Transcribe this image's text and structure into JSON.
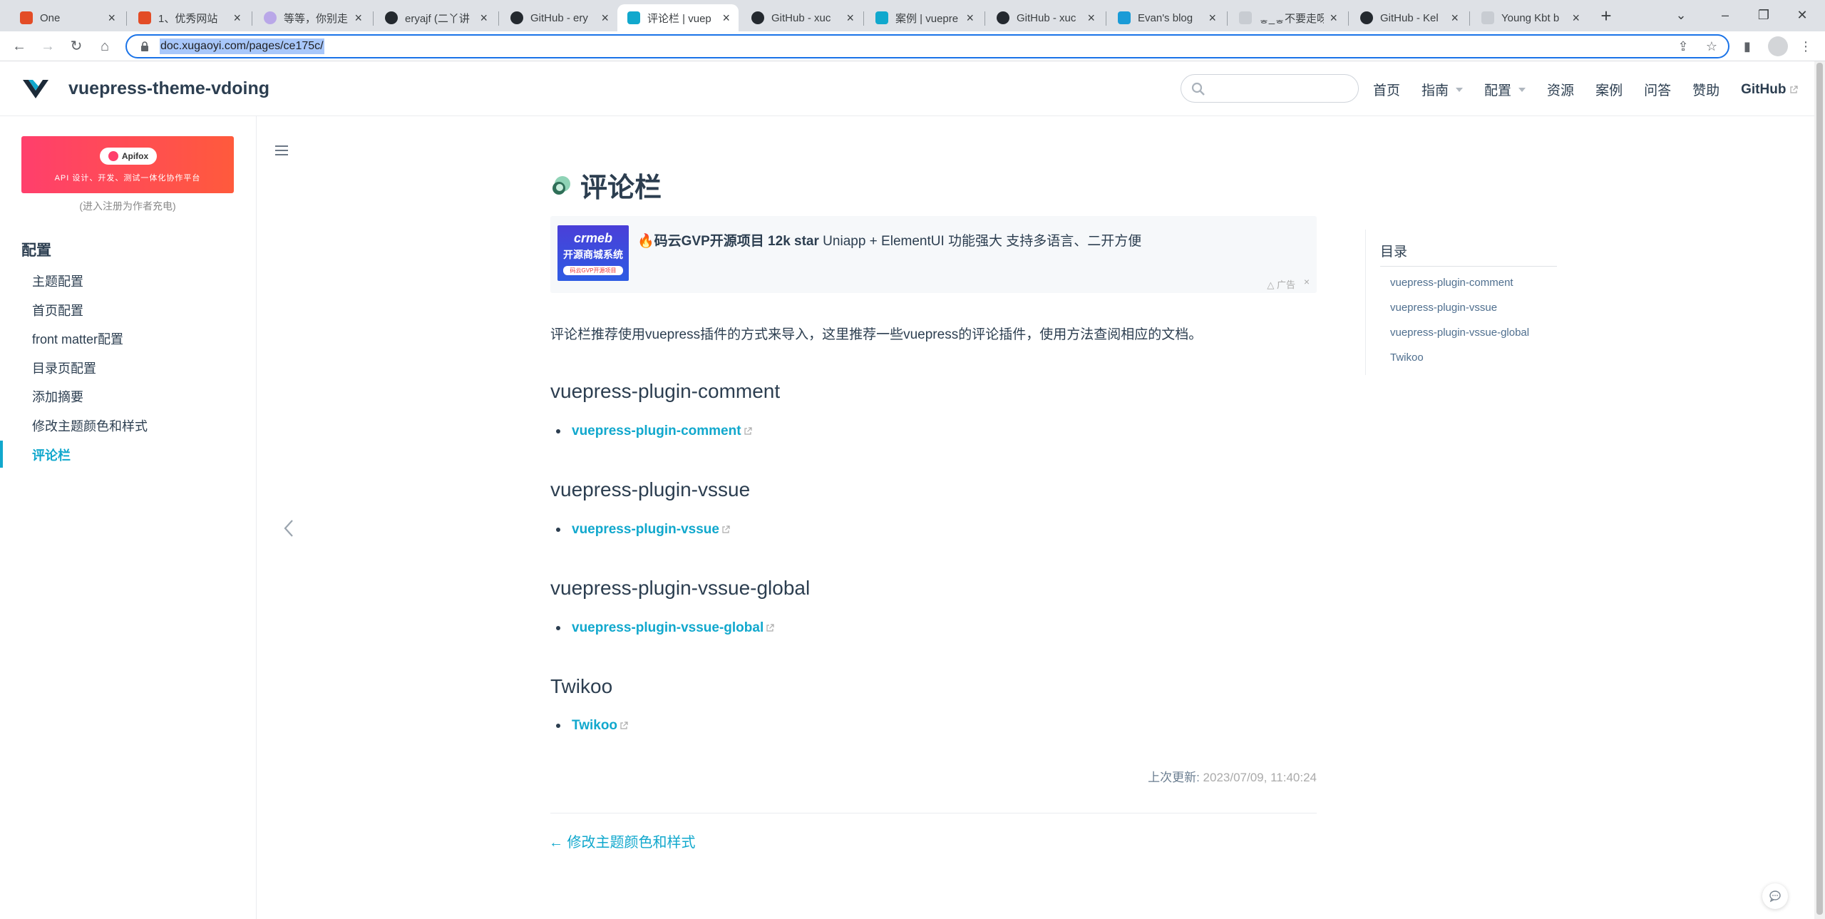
{
  "browser": {
    "tabs": [
      {
        "title": "One",
        "favicon_color": "#e34c26"
      },
      {
        "title": "1、优秀网站",
        "favicon_color": "#e34c26"
      },
      {
        "title": "等等，你别走",
        "favicon_color": "#b9a7e8"
      },
      {
        "title": "eryajf (二丫讲",
        "favicon_color": "#24292f"
      },
      {
        "title": "GitHub - ery",
        "favicon_color": "#24292f"
      },
      {
        "title": "评论栏 | vuep",
        "favicon_color": "#11a8cd"
      },
      {
        "title": "GitHub - xuc",
        "favicon_color": "#24292f"
      },
      {
        "title": "案例 | vuepre",
        "favicon_color": "#11a8cd"
      },
      {
        "title": "GitHub - xuc",
        "favicon_color": "#24292f"
      },
      {
        "title": "Evan's blog",
        "favicon_color": "#1a9bd7"
      },
      {
        "title": "ᇂ_ᇂ不要走呀",
        "favicon_color": "#9aa0a6"
      },
      {
        "title": "GitHub - Kel",
        "favicon_color": "#24292f"
      },
      {
        "title": "Young Kbt b",
        "favicon_color": "#9aa0a6"
      }
    ],
    "active_tab_index": 5,
    "url": "doc.xugaoyi.com/pages/ce175c/"
  },
  "navbar": {
    "site_name": "vuepress-theme-vdoing",
    "search_placeholder": "",
    "links": [
      {
        "label": "首页",
        "dropdown": false
      },
      {
        "label": "指南",
        "dropdown": true
      },
      {
        "label": "配置",
        "dropdown": true
      },
      {
        "label": "资源",
        "dropdown": false
      },
      {
        "label": "案例",
        "dropdown": false
      },
      {
        "label": "问答",
        "dropdown": false
      },
      {
        "label": "赞助",
        "dropdown": false
      }
    ],
    "github_label": "GitHub"
  },
  "sidebar": {
    "ad_brand": "Apifox",
    "ad_text": "API 设计、开发、测试一体化协作平台",
    "ad_note": "(进入注册为作者充电)",
    "group_title": "配置",
    "items": [
      "主题配置",
      "首页配置",
      "front matter配置",
      "目录页配置",
      "添加摘要",
      "修改主题颜色和样式",
      "评论栏"
    ],
    "active_index": 6
  },
  "main": {
    "title": "评论栏",
    "ad": {
      "img_line1": "crmeb",
      "img_line2": "开源商城系统",
      "img_line3": "码云GVP开源项目",
      "bold": "🔥码云GVP开源项目 12k star",
      "text": " Uniapp + ElementUI 功能强大 支持多语言、二开方便",
      "label": "广告",
      "close": "×"
    },
    "intro": "评论栏推荐使用vuepress插件的方式来导入，这里推荐一些vuepress的评论插件，使用方法查阅相应的文档。",
    "sections": [
      {
        "heading": "vuepress-plugin-comment",
        "link": "vuepress-plugin-comment"
      },
      {
        "heading": "vuepress-plugin-vssue",
        "link": "vuepress-plugin-vssue"
      },
      {
        "heading": "vuepress-plugin-vssue-global",
        "link": "vuepress-plugin-vssue-global"
      },
      {
        "heading": "Twikoo",
        "link": "Twikoo"
      }
    ],
    "last_updated_label": "上次更新:",
    "last_updated_time": "2023/07/09, 11:40:24",
    "prev_link": "← 修改主题颜色和样式"
  },
  "toc": {
    "title": "目录",
    "items": [
      "vuepress-plugin-comment",
      "vuepress-plugin-vssue",
      "vuepress-plugin-vssue-global",
      "Twikoo"
    ]
  },
  "colors": {
    "accent": "#11a8cd",
    "text": "#2c3e50"
  }
}
